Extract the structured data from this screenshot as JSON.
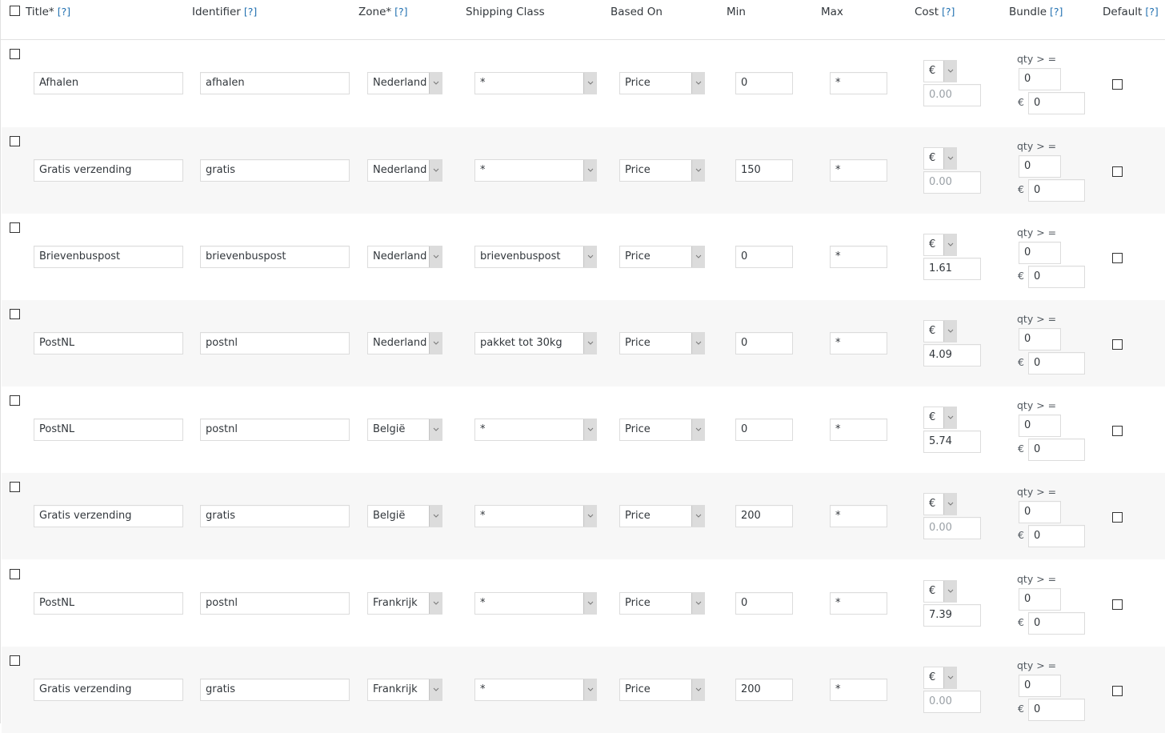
{
  "header": {
    "columns": {
      "title": "Title*",
      "identifier": "Identifier",
      "zone": "Zone*",
      "shipping_class": "Shipping Class",
      "based_on": "Based On",
      "min": "Min",
      "max": "Max",
      "cost": "Cost",
      "bundle": "Bundle",
      "default": "Default"
    },
    "help_link": "[?]"
  },
  "labels": {
    "qty_gte": "qty > =",
    "currency_symbol": "€",
    "cost_placeholder": "0.00"
  },
  "rows": [
    {
      "title": "Afhalen",
      "identifier": "afhalen",
      "zone": "Nederland",
      "shipping_class": "*",
      "based_on": "Price",
      "min": "0",
      "max": "*",
      "cost_currency": "€",
      "cost": "",
      "bundle_qty": "0",
      "bundle_cost": "0",
      "default": false,
      "selected": false
    },
    {
      "title": "Gratis verzending",
      "identifier": "gratis",
      "zone": "Nederland",
      "shipping_class": "*",
      "based_on": "Price",
      "min": "150",
      "max": "*",
      "cost_currency": "€",
      "cost": "",
      "bundle_qty": "0",
      "bundle_cost": "0",
      "default": false,
      "selected": false
    },
    {
      "title": "Brievenbuspost",
      "identifier": "brievenbuspost",
      "zone": "Nederland",
      "shipping_class": "brievenbuspost",
      "based_on": "Price",
      "min": "0",
      "max": "*",
      "cost_currency": "€",
      "cost": "1.61",
      "bundle_qty": "0",
      "bundle_cost": "0",
      "default": false,
      "selected": false
    },
    {
      "title": "PostNL",
      "identifier": "postnl",
      "zone": "Nederland",
      "shipping_class": "pakket tot 30kg",
      "based_on": "Price",
      "min": "0",
      "max": "*",
      "cost_currency": "€",
      "cost": "4.09",
      "bundle_qty": "0",
      "bundle_cost": "0",
      "default": false,
      "selected": false
    },
    {
      "title": "PostNL",
      "identifier": "postnl",
      "zone": "België",
      "shipping_class": "*",
      "based_on": "Price",
      "min": "0",
      "max": "*",
      "cost_currency": "€",
      "cost": "5.74",
      "bundle_qty": "0",
      "bundle_cost": "0",
      "default": false,
      "selected": false
    },
    {
      "title": "Gratis verzending",
      "identifier": "gratis",
      "zone": "België",
      "shipping_class": "*",
      "based_on": "Price",
      "min": "200",
      "max": "*",
      "cost_currency": "€",
      "cost": "",
      "bundle_qty": "0",
      "bundle_cost": "0",
      "default": false,
      "selected": false
    },
    {
      "title": "PostNL",
      "identifier": "postnl",
      "zone": "Frankrijk",
      "shipping_class": "*",
      "based_on": "Price",
      "min": "0",
      "max": "*",
      "cost_currency": "€",
      "cost": "7.39",
      "bundle_qty": "0",
      "bundle_cost": "0",
      "default": false,
      "selected": false
    },
    {
      "title": "Gratis verzending",
      "identifier": "gratis",
      "zone": "Frankrijk",
      "shipping_class": "*",
      "based_on": "Price",
      "min": "200",
      "max": "*",
      "cost_currency": "€",
      "cost": "",
      "bundle_qty": "0",
      "bundle_cost": "0",
      "default": false,
      "selected": false
    }
  ]
}
